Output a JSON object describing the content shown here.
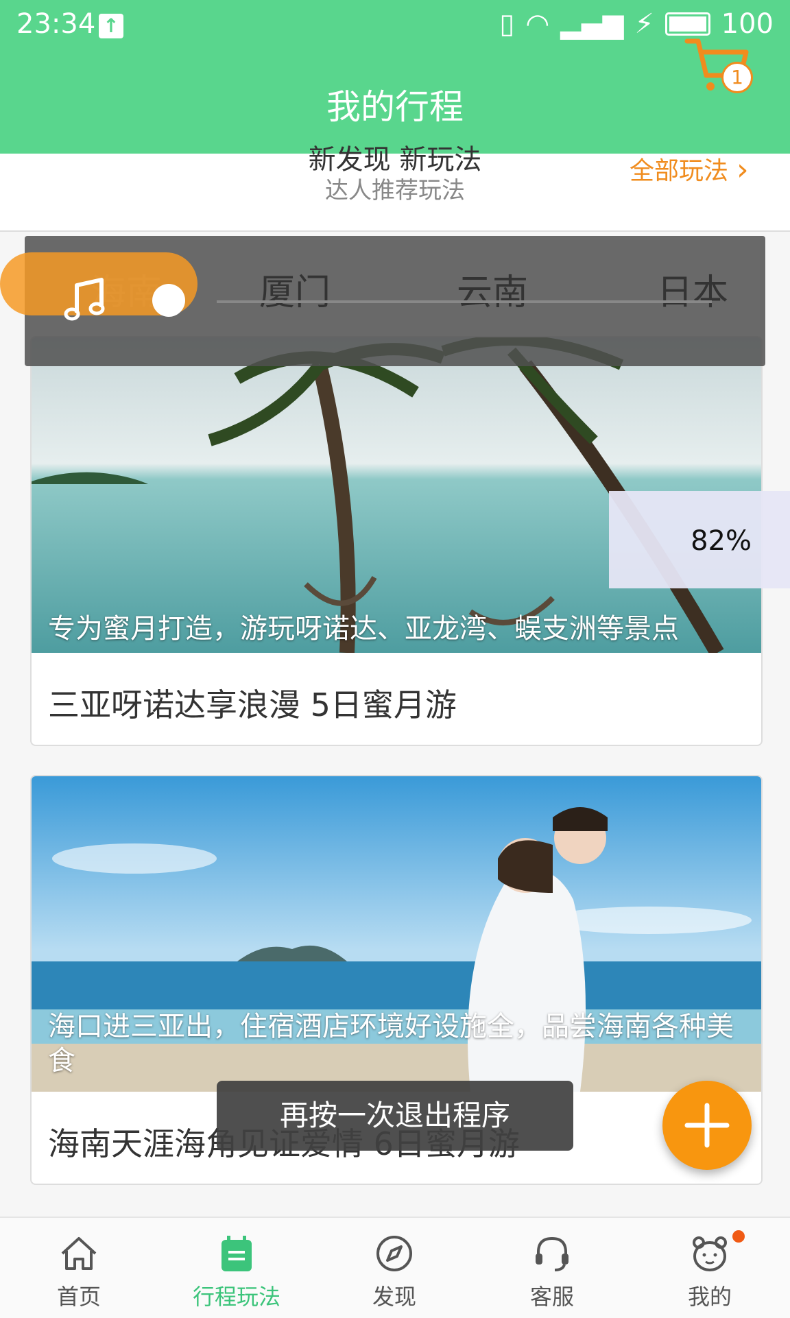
{
  "status": {
    "time": "23:34",
    "battery": "100"
  },
  "header": {
    "title": "我的行程",
    "cart_count": "1"
  },
  "discover": {
    "main": "新发现 新玩法",
    "sub": "达人推荐玩法",
    "all_label": "全部玩法"
  },
  "tabs": [
    "海南",
    "厦门",
    "云南",
    "日本"
  ],
  "cards": [
    {
      "caption": "专为蜜月打造，游玩呀诺达、亚龙湾、蜈支洲等景点",
      "title": "三亚呀诺达享浪漫 5日蜜月游"
    },
    {
      "caption": "海口进三亚出，住宿酒店环境好设施全，品尝海南各种美食",
      "title": "海南天涯海角见证爱情 6日蜜月游"
    }
  ],
  "progress": {
    "value": "82%"
  },
  "toast": "再按一次退出程序",
  "nav": [
    {
      "label": "首页",
      "icon": "home-icon"
    },
    {
      "label": "行程玩法",
      "icon": "calendar-icon"
    },
    {
      "label": "发现",
      "icon": "compass-icon"
    },
    {
      "label": "客服",
      "icon": "headset-icon"
    },
    {
      "label": "我的",
      "icon": "bear-face-icon"
    }
  ],
  "colors": {
    "primary": "#59d68d",
    "accent": "#f08c1e",
    "fab": "#f8960f"
  }
}
